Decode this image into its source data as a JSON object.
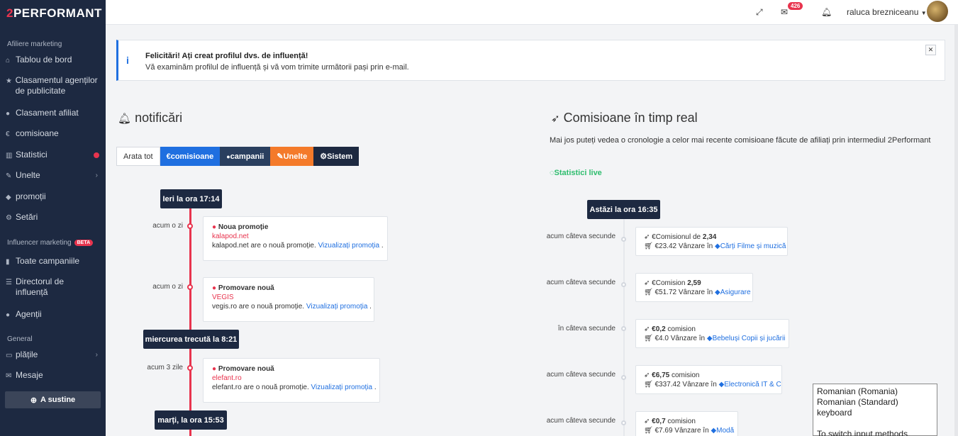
{
  "brand": {
    "logo_prefix": "2",
    "logo_text": "PERFORMANT"
  },
  "sidebar": {
    "section_affiliate": "Afiliere marketing",
    "items": [
      {
        "label": "Tablou de bord",
        "icon": "home-icon"
      },
      {
        "label": "Clasamentul agenților de publicitate",
        "icon": "star-icon"
      },
      {
        "label": "Clasament afiliat",
        "icon": "user-icon"
      },
      {
        "label": "comisioane",
        "icon": "euro-icon"
      },
      {
        "label": "Statistici",
        "icon": "bar-chart-icon"
      },
      {
        "label": "Unelte",
        "icon": "wrench-icon"
      },
      {
        "label": "promoții",
        "icon": "tag-icon"
      },
      {
        "label": "Setări",
        "icon": "gear-icon"
      }
    ],
    "section_influencer": "Influencer marketing",
    "beta": "BETA",
    "influencer_items": [
      {
        "label": "Toate campaniile",
        "icon": "bookmark-icon"
      },
      {
        "label": "Directorul de influență",
        "icon": "list-icon"
      },
      {
        "label": "Agenții",
        "icon": "users-icon"
      }
    ],
    "section_general": "General",
    "general_items": [
      {
        "label": "plățile",
        "icon": "card-icon"
      },
      {
        "label": "Mesaje",
        "icon": "envelope-icon"
      }
    ],
    "support_button": "A sustine"
  },
  "topbar": {
    "messages_count": "426",
    "user_name": "raluca brezniceanu"
  },
  "alert": {
    "title": "Felicitări! Ați creat profilul dvs. de influență!",
    "body": "Vă examinăm profilul de influență și vă vom trimite următorii pași prin e-mail."
  },
  "notifications": {
    "title": "notificări",
    "filters": [
      {
        "label": "Arata tot",
        "color": "#ffffff"
      },
      {
        "label": "comisioane",
        "color": "#1f6fe0"
      },
      {
        "label": "campanii",
        "color": "#2a3f5f"
      },
      {
        "label": "Unelte",
        "color": "#f47a2a"
      },
      {
        "label": "Sistem",
        "color": "#1d2941"
      }
    ],
    "dates": [
      "Ieri la ora 17:14",
      "miercurea trecută la 8:21",
      "marți, la ora 15:53"
    ],
    "entries": [
      {
        "ago": "acum o zi",
        "title": "Noua promoție",
        "source": "kalapod.net",
        "desc": "kalapod.net are o nouă promoție.",
        "link": "Vizualizați promoția"
      },
      {
        "ago": "acum o zi",
        "title": "Promovare nouă",
        "source": "VEGIS",
        "desc": "vegis.ro are o nouă promoție.",
        "link": "Vizualizați promoția"
      },
      {
        "ago": "acum 3 zile",
        "title": "Promovare nouă",
        "source": "elefant.ro",
        "desc": "elefant.ro are o nouă promoție.",
        "link": "Vizualizați promoția"
      }
    ]
  },
  "commissions": {
    "title": "Comisioane în timp real",
    "intro": "Mai jos puteți vedea o cronologie a celor mai recente comisioane făcute de afiliați prin intermediul 2Performant",
    "live": "Statistici live",
    "date": "Astăzi la ora 16:35",
    "entries": [
      {
        "ago": "acum câteva secunde",
        "pre": "€Comisionul de ",
        "amount": "2,34",
        "post": "",
        "sale": "€23.42 Vânzare în",
        "category": "Cărți Filme și muzică"
      },
      {
        "ago": "acum câteva secunde",
        "pre": "€Comision ",
        "amount": "2,59",
        "post": "",
        "sale": "€51.72 Vânzare în",
        "category": "Asigurare"
      },
      {
        "ago": "în câteva secunde",
        "pre": "",
        "amount": "€0,2",
        "post": " comision",
        "sale": "€4.0 Vânzare în",
        "category": "Bebeluși Copii și jucării"
      },
      {
        "ago": "acum câteva secunde",
        "pre": "",
        "amount": "€6,75",
        "post": " comision",
        "sale": "€337.42 Vânzare în",
        "category": "Electronică IT & C"
      },
      {
        "ago": "acum câteva secunde",
        "pre": "",
        "amount": "€0,7",
        "post": " comision",
        "sale": "€7.69 Vânzare în",
        "category": "Modă"
      }
    ]
  },
  "tooltip": {
    "line1": "Romanian (Romania)",
    "line2": "Romanian (Standard) keyboard",
    "line3": "To switch input methods, press Windows key+Space."
  }
}
